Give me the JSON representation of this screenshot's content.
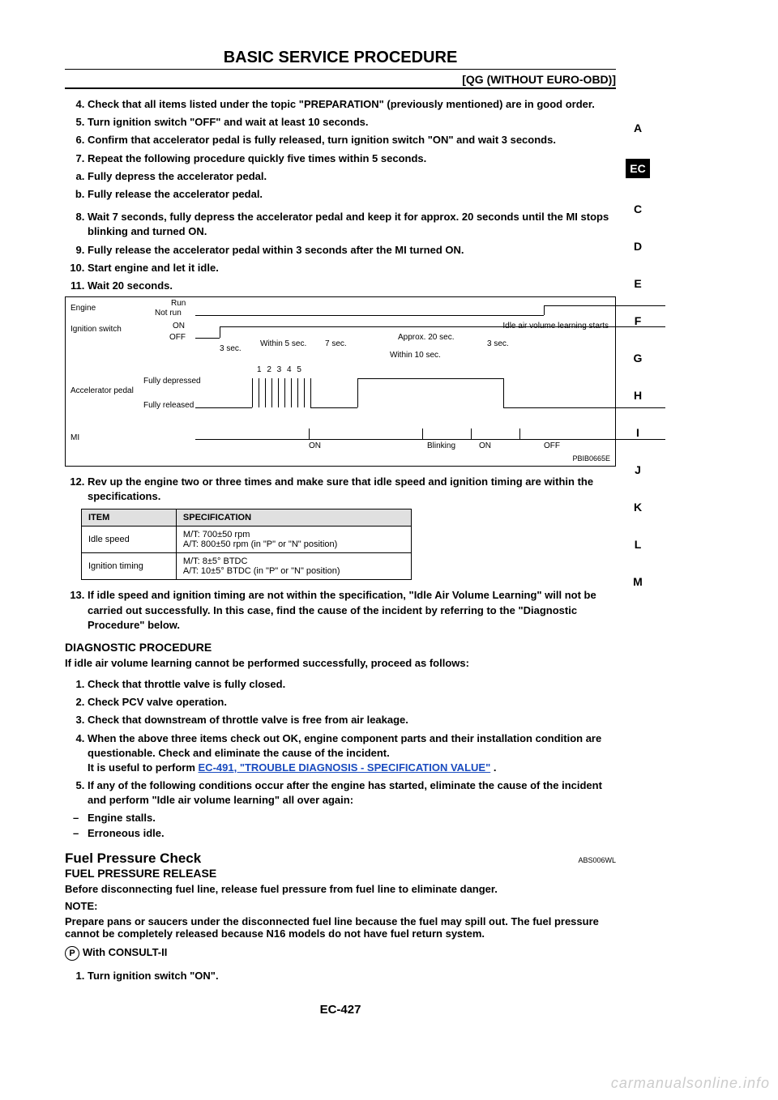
{
  "header": {
    "title": "BASIC SERVICE PROCEDURE",
    "subtitle": "[QG (WITHOUT EURO-OBD)]"
  },
  "sidebar": [
    "A",
    "EC",
    "C",
    "D",
    "E",
    "F",
    "G",
    "H",
    "I",
    "J",
    "K",
    "L",
    "M"
  ],
  "steps4to11": {
    "s4": "Check that all items listed under the topic \"PREPARATION\" (previously mentioned) are in good order.",
    "s5": "Turn ignition switch \"OFF\" and wait at least 10 seconds.",
    "s6": "Confirm that accelerator pedal is fully released, turn ignition switch \"ON\" and wait 3 seconds.",
    "s7": "Repeat the following procedure quickly five times within 5 seconds.",
    "s7a": "Fully depress the accelerator pedal.",
    "s7b": "Fully release the accelerator pedal.",
    "s8": "Wait 7 seconds, fully depress the accelerator pedal and keep it for approx. 20 seconds until the MI stops blinking and turned ON.",
    "s9": "Fully release the accelerator pedal within 3 seconds after the MI turned ON.",
    "s10": "Start engine and let it idle.",
    "s11": "Wait 20 seconds."
  },
  "diagram": {
    "engine_run": "Run",
    "engine_notrun": "Not run",
    "engine": "Engine",
    "ign": "Ignition switch",
    "ign_on": "ON",
    "ign_off": "OFF",
    "accel": "Accelerator pedal",
    "accel_dep": "Fully depressed",
    "accel_rel": "Fully released",
    "mi": "MI",
    "within5": "Within 5 sec.",
    "sec3a": "3 sec.",
    "sec7": "7 sec.",
    "approx20": "Approx. 20 sec.",
    "sec3b": "3 sec.",
    "within10": "Within 10 sec.",
    "counts": "1 2 3 4 5",
    "idle_starts": "Idle air volume learning starts",
    "mi_on": "ON",
    "mi_blink": "Blinking",
    "mi_on2": "ON",
    "mi_off": "OFF",
    "code": "PBIB0665E"
  },
  "step12": "Rev up the engine two or three times and make sure that idle speed and ignition timing are within the specifications.",
  "spec_table": {
    "h_item": "ITEM",
    "h_spec": "SPECIFICATION",
    "r1_item": "Idle speed",
    "r1_spec": "M/T: 700±50 rpm\nA/T: 800±50 rpm (in \"P\" or \"N\" position)",
    "r2_item": "Ignition timing",
    "r2_spec": "M/T: 8±5° BTDC\nA/T: 10±5° BTDC (in \"P\" or \"N\" position)"
  },
  "step13": "If idle speed and ignition timing are not within the specification, \"Idle Air Volume Learning\" will not be carried out successfully. In this case, find the cause of the incident by referring to the \"Diagnostic Procedure\" below.",
  "diag": {
    "head": "DIAGNOSTIC PROCEDURE",
    "intro": "If idle air volume learning cannot be performed successfully, proceed as follows:",
    "d1": "Check that throttle valve is fully closed.",
    "d2": "Check PCV valve operation.",
    "d3": "Check that downstream of throttle valve is free from air leakage.",
    "d4a": "When the above three items check out OK, engine component parts and their installation condition are questionable. Check and eliminate the cause of the incident.",
    "d4b": "It is useful to perform ",
    "d4link": "EC-491, \"TROUBLE DIAGNOSIS - SPECIFICATION VALUE\"",
    "d4c": " .",
    "d5": "If any of the following conditions occur after the engine has started, eliminate the cause of the incident and perform \"Idle air volume learning\" all over again:",
    "dash1": "Engine stalls.",
    "dash2": "Erroneous idle."
  },
  "fuel": {
    "head": "Fuel Pressure Check",
    "code": "ABS006WL",
    "sub": "FUEL PRESSURE RELEASE",
    "line1": "Before disconnecting fuel line, release fuel pressure from fuel line to eliminate danger.",
    "note": "NOTE:",
    "note_body": "Prepare pans or saucers under the disconnected fuel line because the fuel may spill out. The fuel pressure cannot be completely released because N16 models do not have fuel return system.",
    "with": "With CONSULT-II",
    "w1": "Turn ignition switch \"ON\"."
  },
  "pagenum": "EC-427",
  "watermark": "carmanualsonline.info"
}
